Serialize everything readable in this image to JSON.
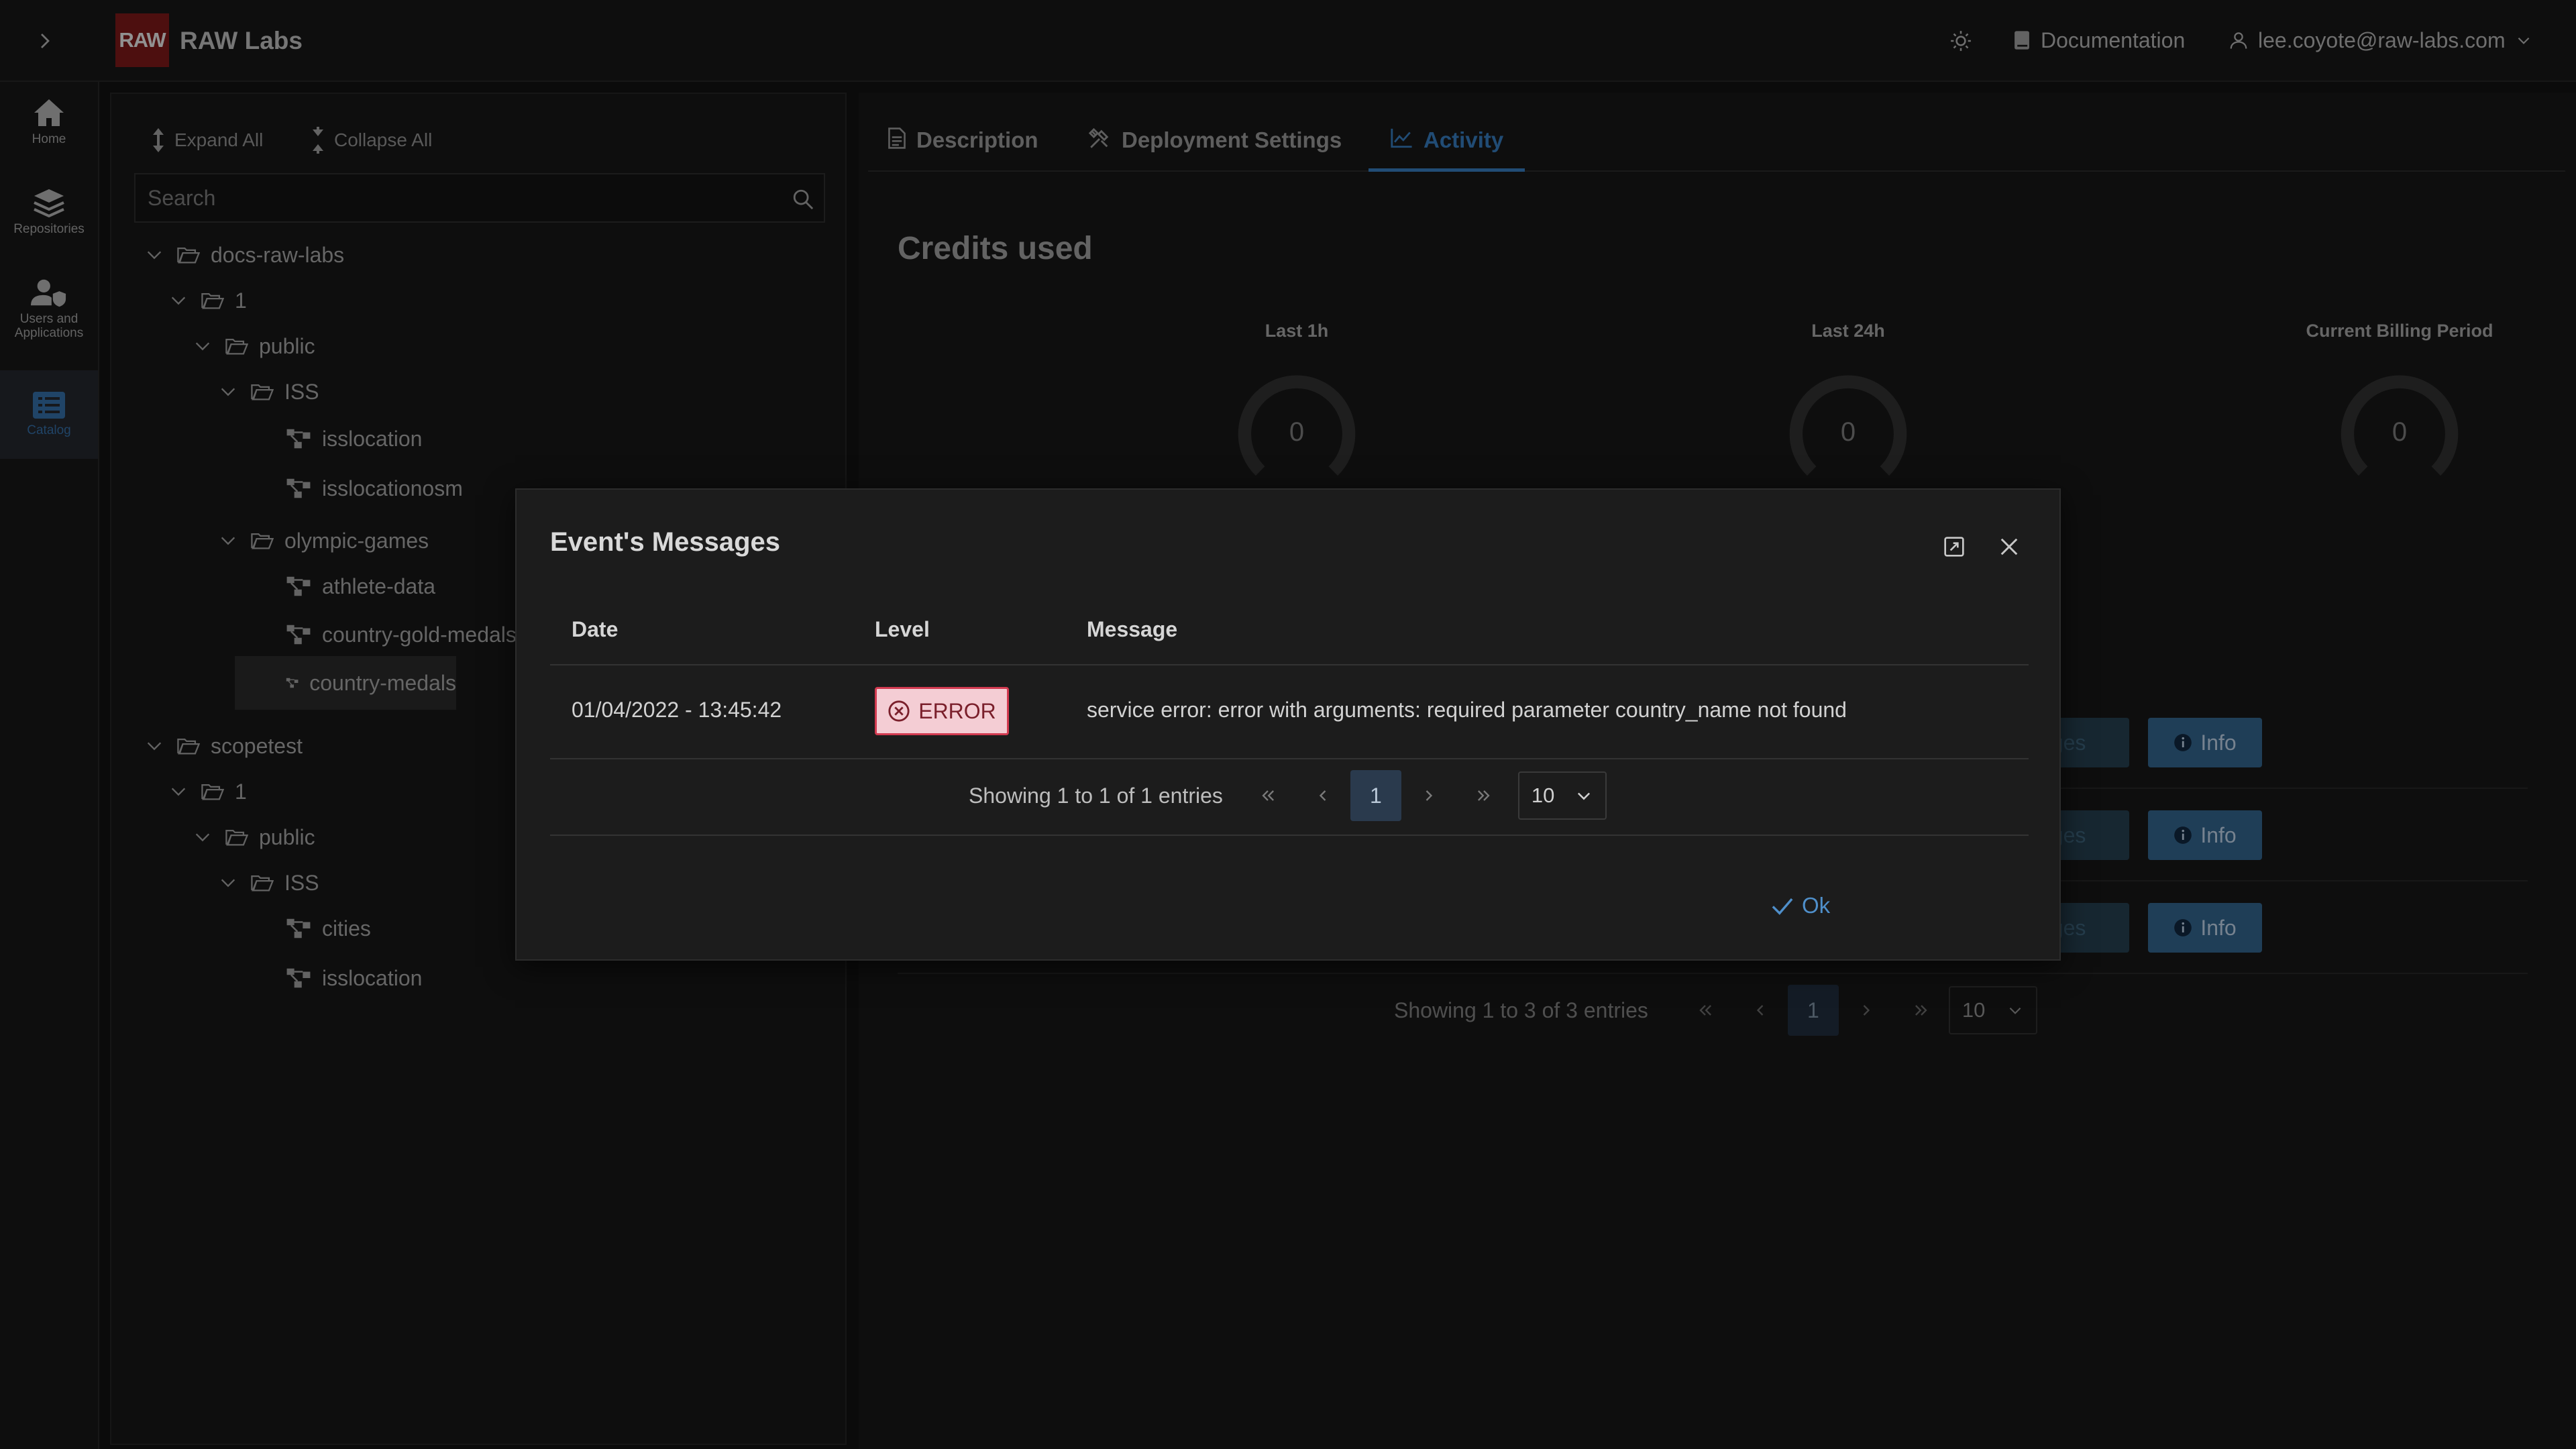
{
  "app": {
    "brand": "RAW Labs",
    "logo_text": "RAW",
    "documentation": "Documentation",
    "user": "lee.coyote@raw-labs.com"
  },
  "rail": {
    "home": "Home",
    "repositories": "Repositories",
    "users": "Users and Applications",
    "catalog": "Catalog"
  },
  "tree": {
    "expand_all": "Expand All",
    "collapse_all": "Collapse All",
    "search_placeholder": "Search",
    "nodes": {
      "docs_raw_labs": "docs-raw-labs",
      "v1": "1",
      "public": "public",
      "iss": "ISS",
      "isslocation": "isslocation",
      "isslocationosm": "isslocationosm",
      "olympic_games": "olympic-games",
      "athlete_data": "athlete-data",
      "country_gold_medals": "country-gold-medals",
      "country_medals": "country-medals",
      "scopetest": "scopetest",
      "s_v1": "1",
      "s_public": "public",
      "s_iss": "ISS",
      "cities": "cities",
      "s_isslocation": "isslocation"
    }
  },
  "tabs": {
    "description": "Description",
    "deployment": "Deployment Settings",
    "activity": "Activity"
  },
  "activity": {
    "credits_title": "Credits used",
    "gauges": [
      {
        "label": "Last 1h",
        "value": "0"
      },
      {
        "label": "Last 24h",
        "value": "0"
      },
      {
        "label": "Current Billing Period",
        "value": "0"
      }
    ],
    "row_msg_label": "sages",
    "row_info_label": "Info",
    "pager_text": "Showing 1 to 3 of 3 entries",
    "pager_page": "1",
    "pager_size": "10"
  },
  "dialog": {
    "title": "Event's Messages",
    "columns": {
      "date": "Date",
      "level": "Level",
      "message": "Message"
    },
    "row": {
      "date": "01/04/2022 - 13:45:42",
      "level": "ERROR",
      "message": "service error: error with arguments: required parameter country_name not found"
    },
    "pager_text": "Showing 1 to 1 of 1 entries",
    "pager_page": "1",
    "pager_size": "10",
    "ok": "Ok"
  },
  "colors": {
    "accent": "#2e6aa3",
    "error_bg": "#f4cdd4",
    "error_border": "#d23a50",
    "logo_bg": "#6b1515"
  }
}
